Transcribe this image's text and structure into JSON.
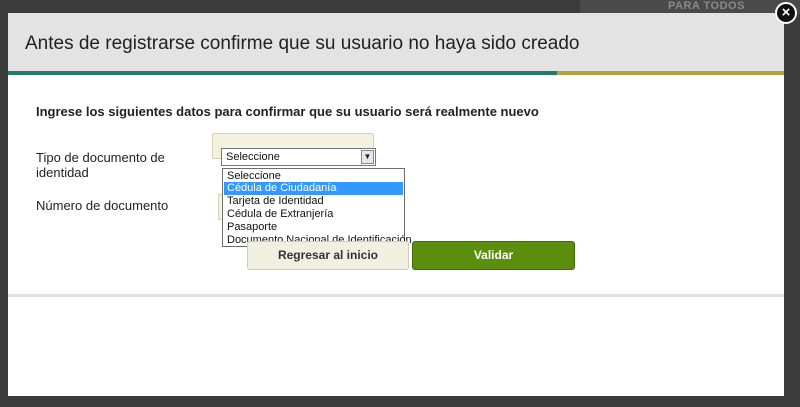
{
  "background": {
    "logo_text": "PARA TODOS"
  },
  "modal": {
    "title": "Antes de registrarse confirme que su usuario no haya sido creado",
    "close_glyph": "×",
    "intro": "Ingrese los siguientes datos para confirmar que su usuario será realmente nuevo"
  },
  "form": {
    "document_type_label": "Tipo de documento de identidad",
    "document_number_label": "Número de documento",
    "select": {
      "value": "Seleccione",
      "arrow_icon": "chevron-down-icon",
      "options": [
        "Seleccione",
        "Cédula de Ciudadanía",
        "Tarjeta de Identidad",
        "Cédula de Extranjería",
        "Pasaporte",
        "Documento Nacional de Identificación"
      ],
      "highlighted_index": 1
    }
  },
  "buttons": {
    "back_label": "Regresar al inicio",
    "validate_label": "Validar"
  },
  "colors": {
    "accent_green": "#5a8e0c",
    "header_bar_teal": "#1f7a6f",
    "header_bar_gold": "#b9a03a",
    "highlight_blue": "#3399ff"
  }
}
